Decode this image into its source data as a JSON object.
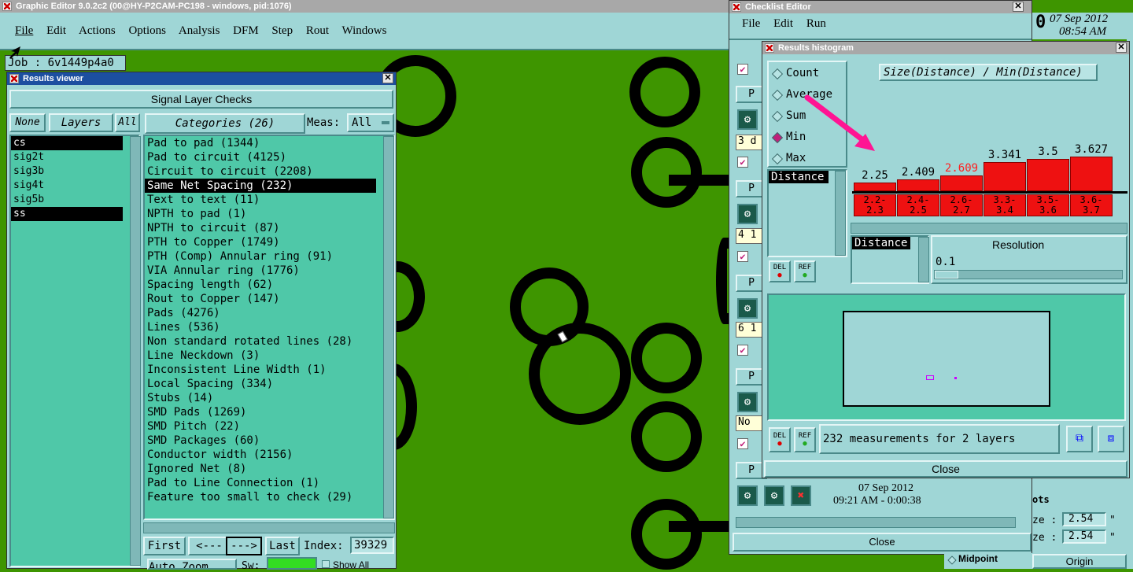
{
  "graphic_editor": {
    "title": "Graphic Editor 9.0.2c2 (00@HY-P2CAM-PC198 - windows, pid:1076)",
    "menu": [
      "File",
      "Edit",
      "Actions",
      "Options",
      "Analysis",
      "DFM",
      "Step",
      "Rout",
      "Windows"
    ],
    "job": "Job : 6v1449p4a0",
    "date": "07 Sep 2012",
    "time": "08:54 AM"
  },
  "results_viewer": {
    "title": "Results viewer",
    "header": "Signal Layer Checks",
    "none_btn": "None",
    "layers_btn": "Layers",
    "all_btn": "All",
    "categories_btn": "Categories (26)",
    "meas_label": "Meas:",
    "meas_value": "All",
    "layers": [
      "cs",
      "sig2t",
      "sig3b",
      "sig4t",
      "sig5b",
      "ss"
    ],
    "categories": [
      "Pad to pad (1344)",
      "Pad to circuit (4125)",
      "Circuit to circuit (2208)",
      "Same Net Spacing (232)",
      "Text to text (11)",
      "NPTH to pad (1)",
      "NPTH to circuit (87)",
      "PTH to Copper (1749)",
      "PTH (Comp) Annular ring (91)",
      "VIA Annular ring (1776)",
      "Spacing length (62)",
      "Rout to Copper (147)",
      "Pads (4276)",
      "Lines (536)",
      "Non standard rotated lines (28)",
      "Line Neckdown (3)",
      "Inconsistent Line Width (1)",
      "Local Spacing (334)",
      "Stubs (14)",
      "SMD Pads (1269)",
      "SMD Pitch (22)",
      "SMD Packages (60)",
      "Conductor width (2156)",
      "Ignored Net (8)",
      "Pad to Line Connection (1)",
      "Feature too small to check (29)"
    ],
    "first_btn": "First",
    "prev_btn": "<---",
    "next_btn": "--->",
    "last_btn": "Last",
    "index_label": "Index:",
    "index_value": "39329",
    "zoom_value": "Auto Zoom",
    "sw_label": "Sw:",
    "show_all": "Show All"
  },
  "checklist_editor": {
    "title": "Checklist Editor",
    "menu": [
      "File",
      "Edit",
      "Run"
    ],
    "row_labels": [
      "P",
      "P",
      "P",
      "P",
      "P",
      "P"
    ],
    "row_values": [
      "3 d",
      "4 1",
      "6 1",
      "No"
    ],
    "date": "07 Sep 2012",
    "time": "09:21 AM - 0:00:38",
    "close": "Close",
    "side_label": "ots",
    "size1_label": "ze :",
    "size1_value": "2.54",
    "size2_label": "ze :",
    "size2_value": "2.54",
    "unit": "\"",
    "midpoint": "Midpoint",
    "origin": "Origin"
  },
  "histogram": {
    "title": "Results histogram",
    "modes": [
      "Count",
      "Average",
      "Sum",
      "Min",
      "Max"
    ],
    "selected_mode": "Min",
    "heading": "Size(Distance) / Min(Distance)",
    "list_item": "Distance",
    "field_item": "Distance",
    "resolution_label": "Resolution",
    "resolution_value": "0.1",
    "del": "DEL",
    "ref": "REF",
    "status": "232 measurements for 2 layers",
    "close": "Close",
    "highlight_color": "#ff2020",
    "arrow_color": "#ff1493"
  },
  "chart_data": {
    "type": "bar",
    "categories": [
      "2.2-\n2.3",
      "2.4-\n2.5",
      "2.6-\n2.7",
      "3.3-\n3.4",
      "3.5-\n3.6",
      "3.6-\n3.7"
    ],
    "values": [
      2.25,
      2.409,
      2.609,
      3.341,
      3.5,
      3.627
    ],
    "value_labels": [
      "2.25",
      "2.409",
      "2.609",
      "3.341",
      "3.5",
      "3.627"
    ],
    "highlight_index": 2,
    "title": "Size(Distance) / Min(Distance)",
    "ylim": [
      1.8,
      3.7
    ]
  }
}
